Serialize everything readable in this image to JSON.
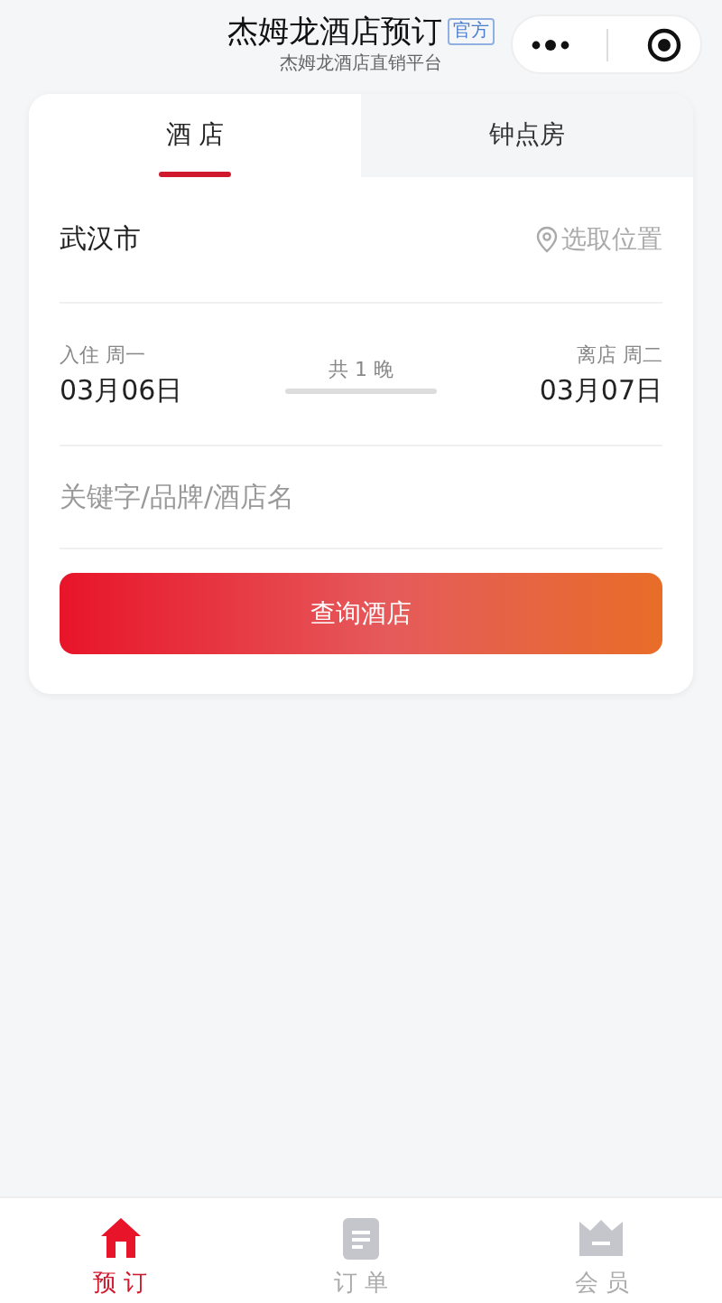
{
  "header": {
    "title": "杰姆龙酒店预订",
    "badge": "官方",
    "subtitle": "杰姆龙酒店直销平台"
  },
  "tabs": [
    {
      "label": "酒 店",
      "selected": true
    },
    {
      "label": "钟点房",
      "selected": false
    }
  ],
  "city": "武汉市",
  "location_button": "选取位置",
  "checkin": {
    "label": "入住 周一",
    "date": "03月06日"
  },
  "nights": "共 1 晚",
  "checkout": {
    "label": "离店 周二",
    "date": "03月07日"
  },
  "keyword": {
    "placeholder": "关键字/品牌/酒店名"
  },
  "search_button": "查询酒店",
  "bottom_nav": [
    {
      "kind": "home",
      "label": "预 订",
      "selected": true
    },
    {
      "kind": "orders",
      "label": "订 单",
      "selected": false
    },
    {
      "kind": "member",
      "label": "会 员",
      "selected": false
    }
  ]
}
